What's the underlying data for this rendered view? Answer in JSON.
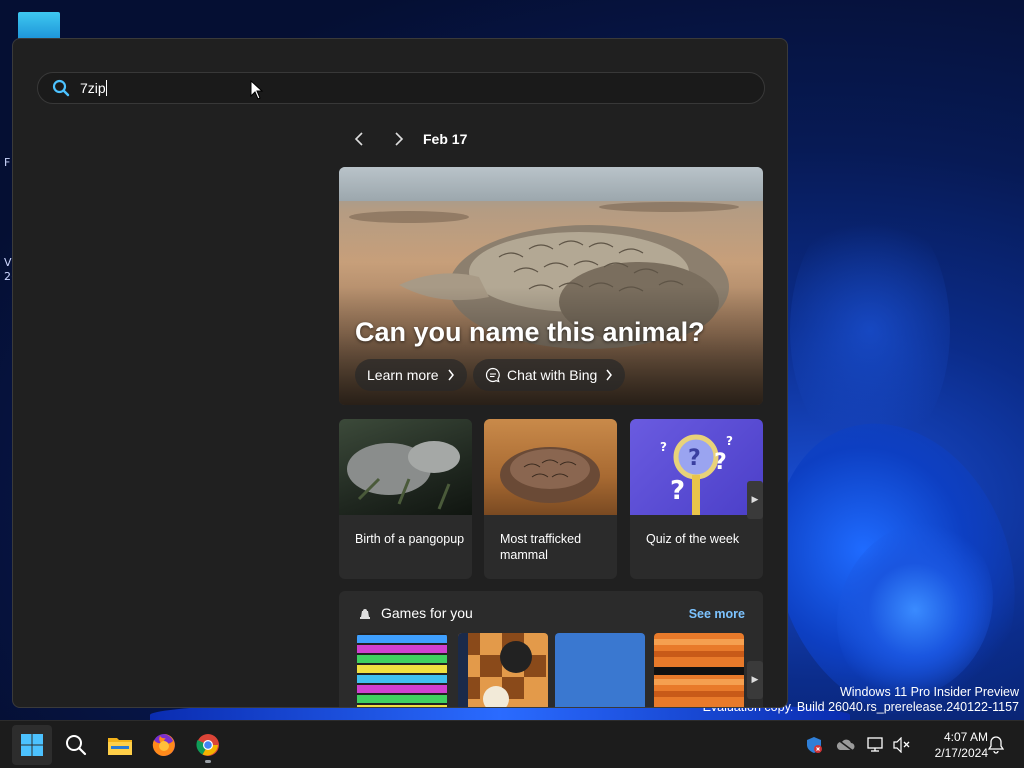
{
  "search": {
    "query": "7zip",
    "placeholder": ""
  },
  "date_nav": {
    "date": "Feb 17"
  },
  "hero": {
    "title": "Can you name this animal?",
    "learn_more": "Learn more",
    "chat_bing": "Chat with Bing"
  },
  "cards": [
    {
      "caption": "Birth of a pangopup"
    },
    {
      "caption": "Most trafficked mammal"
    },
    {
      "caption": "Quiz of the week"
    }
  ],
  "games": {
    "title": "Games for you",
    "see_more": "See more"
  },
  "watermark": {
    "line1": "Windows 11 Pro Insider Preview",
    "line2": "Evaluation copy. Build 26040.rs_prerelease.240122-1157"
  },
  "clock": {
    "time": "4:07 AM",
    "date": "2/17/2024"
  },
  "desktop_edge": {
    "a": "F",
    "b": "V",
    "c": "2("
  },
  "colors": {
    "panel_bg": "#202020",
    "accent_link": "#7cc3ff",
    "windows_blue": "#0078d4"
  },
  "icons": [
    "search-icon",
    "chevron-left-icon",
    "chevron-right-icon",
    "chat-icon",
    "games-icon",
    "start-icon",
    "file-explorer-icon",
    "firefox-icon",
    "chrome-icon",
    "defender-icon",
    "onedrive-icon",
    "network-icon",
    "volume-icon",
    "notification-bell-icon"
  ]
}
